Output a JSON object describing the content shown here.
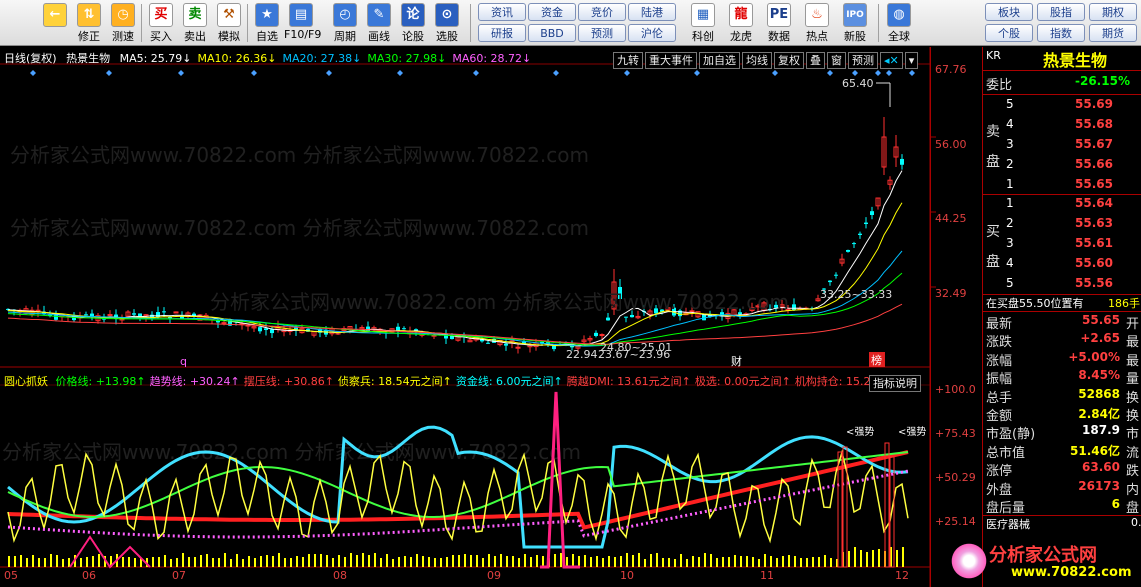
{
  "toolbar": {
    "buttons": [
      {
        "label": "",
        "icon": "back-arrow-icon"
      },
      {
        "label": "修正",
        "icon": "up-down-arrow-icon"
      },
      {
        "label": "测速",
        "icon": "clock-icon"
      },
      {
        "label": "买入",
        "icon": "buy-icon",
        "glyph": "买"
      },
      {
        "label": "卖出",
        "icon": "sell-icon",
        "glyph": "卖"
      },
      {
        "label": "模拟",
        "icon": "hammer-icon"
      },
      {
        "label": "自选",
        "icon": "star-icon"
      },
      {
        "label": "F10/F9",
        "icon": "document-icon"
      },
      {
        "label": "周期",
        "icon": "period-clock-icon"
      },
      {
        "label": "画线",
        "icon": "pencil-icon"
      },
      {
        "label": "论股",
        "icon": "comment-icon"
      },
      {
        "label": "选股",
        "icon": "magnifier-icon"
      }
    ],
    "pills": [
      [
        "资讯",
        "资金",
        "竞价",
        "陆港"
      ],
      [
        "研报",
        "BBD",
        "预测",
        "沪伦"
      ]
    ],
    "buttons2": [
      {
        "label": "科创",
        "icon": "chart-icon"
      },
      {
        "label": "龙虎",
        "icon": "dragon-icon"
      },
      {
        "label": "数据",
        "icon": "pe-icon",
        "glyph": "PE"
      },
      {
        "label": "热点",
        "icon": "fire-icon"
      },
      {
        "label": "新股",
        "icon": "ipo-icon",
        "glyph": "IPO"
      },
      {
        "label": "全球",
        "icon": "globe-icon"
      }
    ],
    "pills2": [
      [
        "板块",
        "股指",
        "期权"
      ],
      [
        "个股",
        "指数",
        "期货"
      ]
    ]
  },
  "kline": {
    "mode": "日线(复权)",
    "name": "热景生物",
    "ma": [
      {
        "label": "MA5: 25.79",
        "color": "#ffffff"
      },
      {
        "label": "MA10: 26.36",
        "color": "#ffff00"
      },
      {
        "label": "MA20: 27.38",
        "color": "#00c0ff"
      },
      {
        "label": "MA30: 27.98",
        "color": "#00ff00"
      },
      {
        "label": "MA60: 28.72",
        "color": "#ff60ff"
      }
    ],
    "tabs": [
      "九转",
      "重大事件",
      "加自选",
      "均线",
      "复权",
      "叠",
      "窗",
      "预测"
    ],
    "price_high": "65.40",
    "range_label": "33.25~33.33",
    "low_label1": "24.80~25.01",
    "low_label2": "22.94",
    "low_label3": "23.67~23.96",
    "mark_q": "q",
    "mark_cai": "财",
    "mark_bang": "榜",
    "price_axis": [
      "67.76",
      "56.00",
      "44.25",
      "32.49"
    ]
  },
  "indicator": {
    "name": "圆心抓妖",
    "items": [
      {
        "label": "价格线: +13.98",
        "color": "#00ff00"
      },
      {
        "label": "趋势线: +30.24",
        "color": "#ff60ff"
      },
      {
        "label": "摆压线: +30.86",
        "color": "#ff4040"
      },
      {
        "label": "侦察兵: 18.54元之间",
        "color": "#ffff00"
      },
      {
        "label": "资金线: 6.00元之间",
        "color": "#00ffff"
      },
      {
        "label": "腾越DMI: 13.61元之间",
        "color": "#ff4040"
      },
      {
        "label": "极选: 0.00元之间",
        "color": "#ff4040"
      },
      {
        "label": "机构持仓: 15.24元",
        "color": "#ff4040"
      }
    ],
    "help": "指标说明",
    "axis": [
      "+100.0",
      "+75.43",
      "+50.29",
      "+25.14"
    ],
    "strong1": "<强势",
    "strong2": "<强势"
  },
  "xaxis": [
    "05",
    "06",
    "07",
    "08",
    "09",
    "10",
    "11",
    "12"
  ],
  "panel": {
    "code": "KR",
    "title": "热景生物",
    "webi_label": "委比",
    "webi": "-26.15%",
    "sell_label": "卖盘",
    "buy_label": "买盘",
    "sell": [
      {
        "n": "5",
        "p": "55.69"
      },
      {
        "n": "4",
        "p": "55.68"
      },
      {
        "n": "3",
        "p": "55.67"
      },
      {
        "n": "2",
        "p": "55.66"
      },
      {
        "n": "1",
        "p": "55.65"
      }
    ],
    "buy": [
      {
        "n": "1",
        "p": "55.64"
      },
      {
        "n": "2",
        "p": "55.63"
      },
      {
        "n": "3",
        "p": "55.61"
      },
      {
        "n": "4",
        "p": "55.60"
      },
      {
        "n": "5",
        "p": "55.56"
      }
    ],
    "buy_notice": "在买盘55.50位置有",
    "buy_notice_qty": "186手",
    "stats": [
      {
        "k": "最新",
        "v": "55.65",
        "c": "#ff4040",
        "t": "开"
      },
      {
        "k": "涨跌",
        "v": "+2.65",
        "c": "#ff4040",
        "t": "最"
      },
      {
        "k": "涨幅",
        "v": "+5.00%",
        "c": "#ff4040",
        "t": "最"
      },
      {
        "k": "振幅",
        "v": "8.45%",
        "c": "#ff4040",
        "t": "量"
      },
      {
        "k": "总手",
        "v": "52868",
        "c": "#ffff00",
        "t": "换"
      },
      {
        "k": "金额",
        "v": "2.84亿",
        "c": "#ffff00",
        "t": "换"
      },
      {
        "k": "市盈(静)",
        "v": "187.9",
        "c": "#ffffff",
        "t": "市"
      },
      {
        "k": "总市值",
        "v": "51.46亿",
        "c": "#ffff00",
        "t": "流"
      },
      {
        "k": "涨停",
        "v": "63.60",
        "c": "#ff4040",
        "t": "跌"
      },
      {
        "k": "外盘",
        "v": "26173",
        "c": "#ff4040",
        "t": "内"
      },
      {
        "k": "盘后量",
        "v": "6",
        "c": "#ffff00",
        "t": "盘"
      }
    ],
    "industry": "医疗器械",
    "industry_val": "0.",
    "logo_text": "分析家公式网",
    "logo_url": "www.70822.com"
  },
  "watermark": "分析家公式网www.70822.com"
}
